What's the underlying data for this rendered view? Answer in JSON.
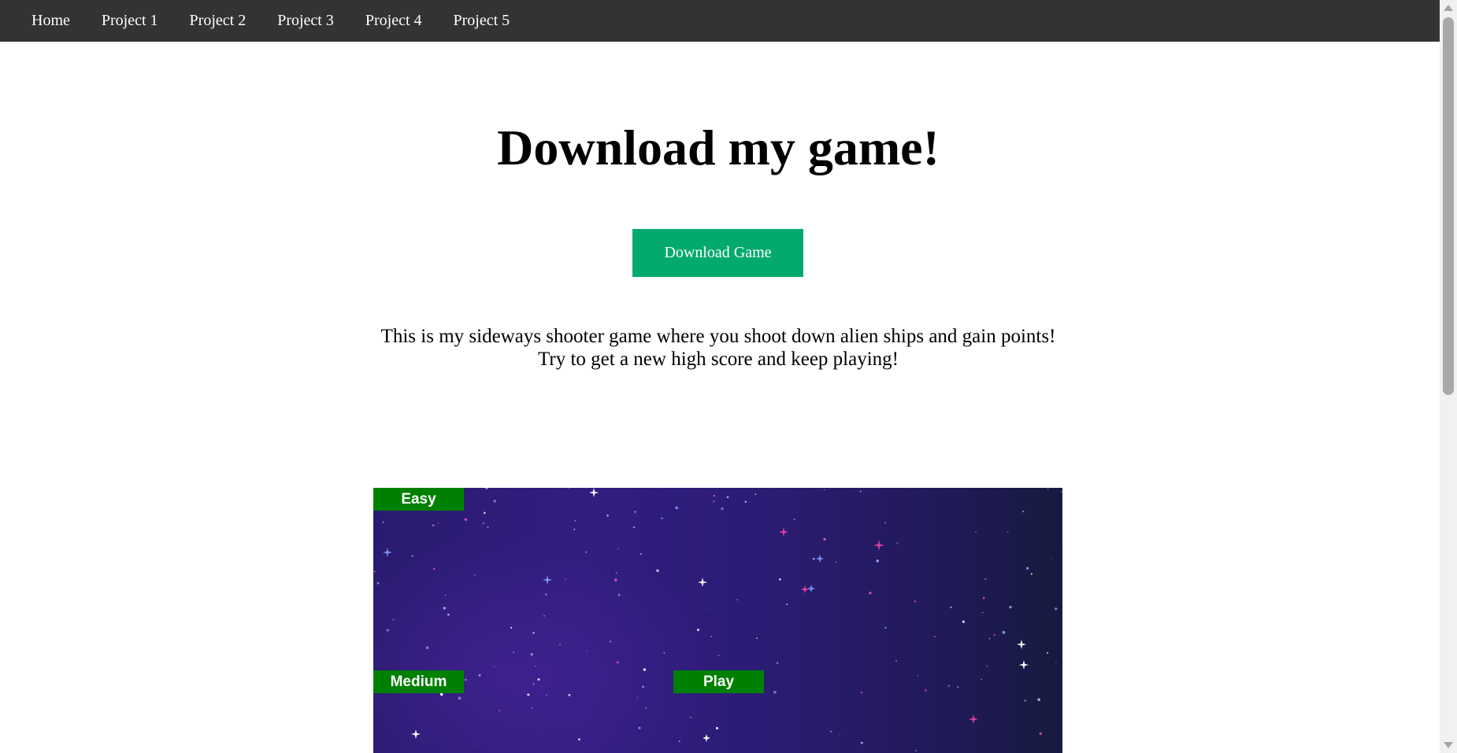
{
  "nav": {
    "items": [
      {
        "label": "Home"
      },
      {
        "label": "Project 1"
      },
      {
        "label": "Project 2"
      },
      {
        "label": "Project 3"
      },
      {
        "label": "Project 4"
      },
      {
        "label": "Project 5"
      }
    ]
  },
  "main": {
    "title": "Download my game!",
    "download_button": "Download Game",
    "description_line1": "This is my sideways shooter game where you shoot down alien ships and gain points!",
    "description_line2": "Try to get a new high score and keep playing!"
  },
  "game": {
    "buttons": {
      "easy": "Easy",
      "medium": "Medium",
      "play": "Play"
    },
    "colors": {
      "button_bg": "#008000",
      "space_bg": "#2c1c76"
    }
  },
  "colors": {
    "navbar": "#333333",
    "download_button": "#04aa6d"
  }
}
